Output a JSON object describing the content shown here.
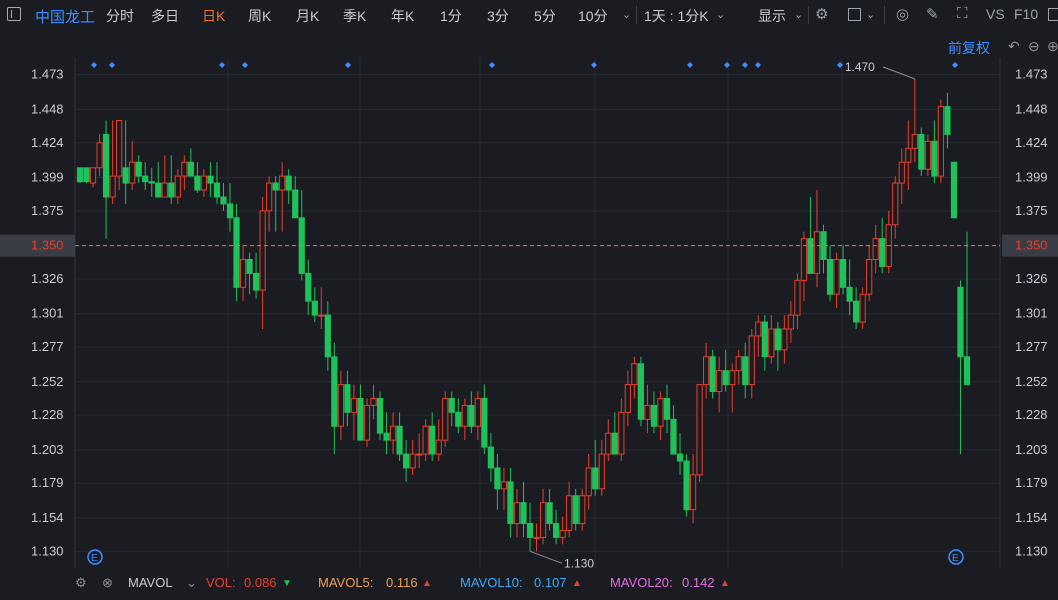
{
  "header": {
    "stock_name": "中国龙工",
    "periods": [
      "分时",
      "多日",
      "日K",
      "周K",
      "月K",
      "季K",
      "年K",
      "1分",
      "3分",
      "5分",
      "10分"
    ],
    "active_period": "日K",
    "range_label": "1天 : 1分K",
    "display_label": "显示",
    "vs_label": "VS",
    "f10_label": "F10"
  },
  "toolbar": {
    "fuquan_label": "前复权"
  },
  "axes": {
    "price_ticks": [
      "1.473",
      "1.448",
      "1.424",
      "1.399",
      "1.375",
      "1.350",
      "1.326",
      "1.301",
      "1.277",
      "1.252",
      "1.228",
      "1.203",
      "1.179",
      "1.154",
      "1.130"
    ],
    "current_price": "1.350",
    "high_label": "1.470",
    "low_label": "1.130",
    "event_marker": "E"
  },
  "indicators": {
    "name": "MAVOL",
    "vol_label": "VOL:",
    "vol_value": "0.086",
    "mavol5_label": "MAVOL5:",
    "mavol5_value": "0.116",
    "mavol10_label": "MAVOL10:",
    "mavol10_value": "0.107",
    "mavol20_label": "MAVOL20:",
    "mavol20_value": "0.142"
  },
  "colors": {
    "up": "#e8402c",
    "down": "#1fc25a",
    "accent": "#3d8fff",
    "active": "#f0722a",
    "mavol5": "#f0a050",
    "mavol10": "#3fa9f5",
    "mavol20": "#e070e0"
  },
  "chart_data": {
    "type": "candlestick",
    "ylim": [
      1.118,
      1.485
    ],
    "current": 1.35,
    "high": 1.47,
    "low": 1.13,
    "candles": [
      [
        1.406,
        1.406,
        1.395,
        1.396
      ],
      [
        1.406,
        1.406,
        1.395,
        1.396
      ],
      [
        1.395,
        1.406,
        1.392,
        1.406
      ],
      [
        1.406,
        1.43,
        1.4,
        1.424
      ],
      [
        1.43,
        1.44,
        1.355,
        1.385
      ],
      [
        1.385,
        1.44,
        1.38,
        1.4
      ],
      [
        1.4,
        1.44,
        1.39,
        1.44
      ],
      [
        1.406,
        1.44,
        1.38,
        1.395
      ],
      [
        1.395,
        1.425,
        1.39,
        1.41
      ],
      [
        1.41,
        1.415,
        1.395,
        1.4
      ],
      [
        1.4,
        1.41,
        1.39,
        1.396
      ],
      [
        1.396,
        1.406,
        1.385,
        1.395
      ],
      [
        1.395,
        1.41,
        1.385,
        1.385
      ],
      [
        1.385,
        1.415,
        1.385,
        1.395
      ],
      [
        1.395,
        1.415,
        1.38,
        1.385
      ],
      [
        1.385,
        1.405,
        1.38,
        1.4
      ],
      [
        1.4,
        1.415,
        1.39,
        1.41
      ],
      [
        1.41,
        1.42,
        1.4,
        1.4
      ],
      [
        1.4,
        1.41,
        1.388,
        1.39
      ],
      [
        1.39,
        1.405,
        1.385,
        1.4
      ],
      [
        1.4,
        1.41,
        1.385,
        1.395
      ],
      [
        1.395,
        1.41,
        1.38,
        1.385
      ],
      [
        1.385,
        1.395,
        1.375,
        1.38
      ],
      [
        1.38,
        1.395,
        1.36,
        1.37
      ],
      [
        1.37,
        1.38,
        1.31,
        1.32
      ],
      [
        1.32,
        1.35,
        1.31,
        1.34
      ],
      [
        1.34,
        1.345,
        1.315,
        1.33
      ],
      [
        1.33,
        1.345,
        1.312,
        1.318
      ],
      [
        1.318,
        1.385,
        1.29,
        1.375
      ],
      [
        1.375,
        1.4,
        1.36,
        1.395
      ],
      [
        1.395,
        1.4,
        1.36,
        1.39
      ],
      [
        1.39,
        1.41,
        1.36,
        1.4
      ],
      [
        1.4,
        1.405,
        1.38,
        1.39
      ],
      [
        1.39,
        1.4,
        1.37,
        1.37
      ],
      [
        1.37,
        1.39,
        1.325,
        1.33
      ],
      [
        1.33,
        1.34,
        1.3,
        1.31
      ],
      [
        1.31,
        1.32,
        1.295,
        1.3
      ],
      [
        1.3,
        1.32,
        1.29,
        1.3
      ],
      [
        1.3,
        1.31,
        1.26,
        1.27
      ],
      [
        1.27,
        1.28,
        1.2,
        1.22
      ],
      [
        1.22,
        1.26,
        1.21,
        1.25
      ],
      [
        1.25,
        1.26,
        1.22,
        1.23
      ],
      [
        1.23,
        1.25,
        1.21,
        1.24
      ],
      [
        1.24,
        1.25,
        1.21,
        1.21
      ],
      [
        1.21,
        1.24,
        1.205,
        1.235
      ],
      [
        1.235,
        1.25,
        1.225,
        1.24
      ],
      [
        1.24,
        1.245,
        1.21,
        1.215
      ],
      [
        1.215,
        1.23,
        1.2,
        1.21
      ],
      [
        1.21,
        1.23,
        1.2,
        1.22
      ],
      [
        1.22,
        1.23,
        1.195,
        1.2
      ],
      [
        1.2,
        1.21,
        1.18,
        1.19
      ],
      [
        1.19,
        1.21,
        1.185,
        1.2
      ],
      [
        1.2,
        1.215,
        1.19,
        1.2
      ],
      [
        1.2,
        1.225,
        1.195,
        1.22
      ],
      [
        1.22,
        1.23,
        1.195,
        1.2
      ],
      [
        1.2,
        1.225,
        1.195,
        1.21
      ],
      [
        1.21,
        1.245,
        1.205,
        1.24
      ],
      [
        1.24,
        1.245,
        1.22,
        1.23
      ],
      [
        1.23,
        1.24,
        1.215,
        1.22
      ],
      [
        1.22,
        1.24,
        1.21,
        1.235
      ],
      [
        1.235,
        1.245,
        1.215,
        1.22
      ],
      [
        1.22,
        1.245,
        1.21,
        1.24
      ],
      [
        1.24,
        1.25,
        1.2,
        1.205
      ],
      [
        1.205,
        1.215,
        1.18,
        1.19
      ],
      [
        1.19,
        1.2,
        1.16,
        1.175
      ],
      [
        1.175,
        1.19,
        1.16,
        1.18
      ],
      [
        1.18,
        1.19,
        1.14,
        1.15
      ],
      [
        1.15,
        1.175,
        1.14,
        1.165
      ],
      [
        1.165,
        1.18,
        1.14,
        1.15
      ],
      [
        1.15,
        1.165,
        1.13,
        1.14
      ],
      [
        1.14,
        1.15,
        1.13,
        1.14
      ],
      [
        1.14,
        1.175,
        1.135,
        1.165
      ],
      [
        1.165,
        1.175,
        1.145,
        1.15
      ],
      [
        1.15,
        1.16,
        1.135,
        1.14
      ],
      [
        1.14,
        1.155,
        1.135,
        1.145
      ],
      [
        1.145,
        1.18,
        1.14,
        1.17
      ],
      [
        1.17,
        1.175,
        1.145,
        1.15
      ],
      [
        1.15,
        1.175,
        1.145,
        1.17
      ],
      [
        1.17,
        1.2,
        1.16,
        1.19
      ],
      [
        1.19,
        1.21,
        1.17,
        1.175
      ],
      [
        1.175,
        1.21,
        1.17,
        1.2
      ],
      [
        1.2,
        1.225,
        1.195,
        1.215
      ],
      [
        1.215,
        1.23,
        1.2,
        1.2
      ],
      [
        1.2,
        1.24,
        1.195,
        1.23
      ],
      [
        1.23,
        1.26,
        1.22,
        1.25
      ],
      [
        1.25,
        1.27,
        1.24,
        1.265
      ],
      [
        1.265,
        1.27,
        1.22,
        1.225
      ],
      [
        1.225,
        1.25,
        1.215,
        1.235
      ],
      [
        1.235,
        1.245,
        1.215,
        1.22
      ],
      [
        1.22,
        1.245,
        1.21,
        1.24
      ],
      [
        1.24,
        1.25,
        1.215,
        1.225
      ],
      [
        1.225,
        1.235,
        1.2,
        1.2
      ],
      [
        1.2,
        1.215,
        1.185,
        1.195
      ],
      [
        1.195,
        1.2,
        1.155,
        1.16
      ],
      [
        1.16,
        1.2,
        1.15,
        1.185
      ],
      [
        1.185,
        1.25,
        1.18,
        1.25
      ],
      [
        1.25,
        1.28,
        1.24,
        1.27
      ],
      [
        1.27,
        1.275,
        1.24,
        1.245
      ],
      [
        1.245,
        1.27,
        1.23,
        1.26
      ],
      [
        1.26,
        1.275,
        1.245,
        1.25
      ],
      [
        1.25,
        1.265,
        1.23,
        1.26
      ],
      [
        1.26,
        1.275,
        1.25,
        1.27
      ],
      [
        1.27,
        1.28,
        1.24,
        1.25
      ],
      [
        1.25,
        1.29,
        1.24,
        1.285
      ],
      [
        1.285,
        1.3,
        1.27,
        1.295
      ],
      [
        1.295,
        1.3,
        1.26,
        1.27
      ],
      [
        1.27,
        1.3,
        1.265,
        1.29
      ],
      [
        1.29,
        1.295,
        1.26,
        1.275
      ],
      [
        1.275,
        1.3,
        1.265,
        1.29
      ],
      [
        1.29,
        1.31,
        1.28,
        1.3
      ],
      [
        1.3,
        1.33,
        1.29,
        1.325
      ],
      [
        1.325,
        1.36,
        1.31,
        1.355
      ],
      [
        1.355,
        1.385,
        1.34,
        1.33
      ],
      [
        1.33,
        1.39,
        1.32,
        1.36
      ],
      [
        1.36,
        1.365,
        1.33,
        1.34
      ],
      [
        1.34,
        1.35,
        1.31,
        1.315
      ],
      [
        1.315,
        1.345,
        1.305,
        1.34
      ],
      [
        1.34,
        1.35,
        1.315,
        1.32
      ],
      [
        1.32,
        1.34,
        1.3,
        1.31
      ],
      [
        1.31,
        1.32,
        1.29,
        1.295
      ],
      [
        1.295,
        1.32,
        1.29,
        1.315
      ],
      [
        1.315,
        1.35,
        1.31,
        1.34
      ],
      [
        1.34,
        1.365,
        1.33,
        1.355
      ],
      [
        1.355,
        1.37,
        1.33,
        1.335
      ],
      [
        1.335,
        1.375,
        1.33,
        1.365
      ],
      [
        1.365,
        1.4,
        1.355,
        1.395
      ],
      [
        1.395,
        1.42,
        1.38,
        1.41
      ],
      [
        1.41,
        1.44,
        1.39,
        1.42
      ],
      [
        1.42,
        1.47,
        1.41,
        1.43
      ],
      [
        1.43,
        1.435,
        1.4,
        1.405
      ],
      [
        1.405,
        1.43,
        1.4,
        1.425
      ],
      [
        1.425,
        1.44,
        1.395,
        1.4
      ],
      [
        1.4,
        1.455,
        1.395,
        1.45
      ],
      [
        1.45,
        1.46,
        1.42,
        1.43
      ],
      [
        1.41,
        1.41,
        1.37,
        1.37
      ],
      [
        1.32,
        1.325,
        1.2,
        1.27
      ],
      [
        1.27,
        1.36,
        1.25,
        1.25
      ]
    ]
  }
}
